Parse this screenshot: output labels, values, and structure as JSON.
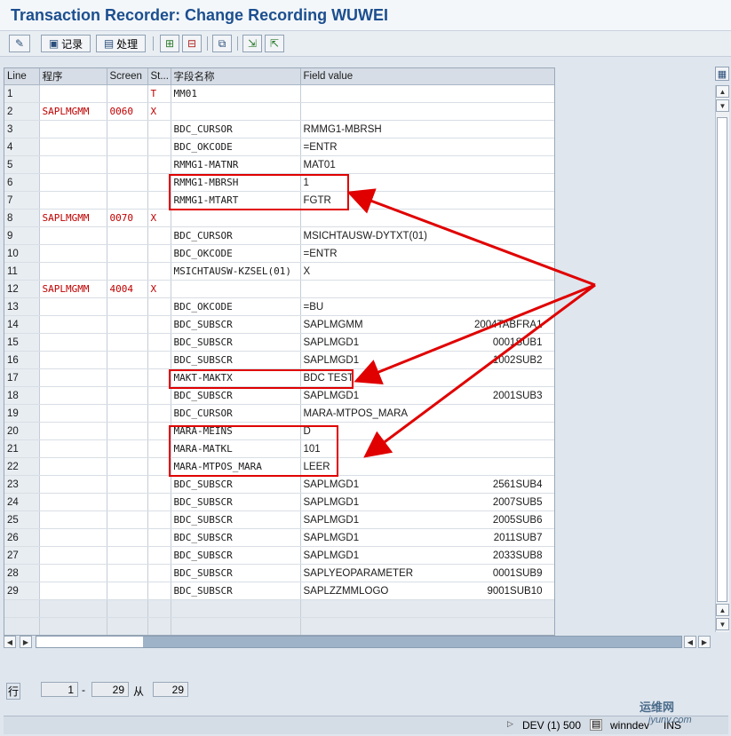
{
  "window": {
    "title": "Transaction Recorder: Change Recording WUWEI"
  },
  "toolbar": {
    "record_label": "记录",
    "process_label": "处理"
  },
  "grid": {
    "columns": [
      "Line",
      "程序",
      "Screen",
      "St...",
      "字段名称",
      "Field value"
    ],
    "rows": [
      {
        "line": "1",
        "program": "",
        "screen": "",
        "st": "T",
        "field": "MM01",
        "value": "",
        "value2": ""
      },
      {
        "line": "2",
        "program": "SAPLMGMM",
        "screen": "0060",
        "st": "X",
        "field": "",
        "value": "",
        "value2": ""
      },
      {
        "line": "3",
        "program": "",
        "screen": "",
        "st": "",
        "field": "BDC_CURSOR",
        "value": "RMMG1-MBRSH",
        "value2": ""
      },
      {
        "line": "4",
        "program": "",
        "screen": "",
        "st": "",
        "field": "BDC_OKCODE",
        "value": "=ENTR",
        "value2": ""
      },
      {
        "line": "5",
        "program": "",
        "screen": "",
        "st": "",
        "field": "RMMG1-MATNR",
        "value": "MAT01",
        "value2": ""
      },
      {
        "line": "6",
        "program": "",
        "screen": "",
        "st": "",
        "field": "RMMG1-MBRSH",
        "value": "1",
        "value2": ""
      },
      {
        "line": "7",
        "program": "",
        "screen": "",
        "st": "",
        "field": "RMMG1-MTART",
        "value": "FGTR",
        "value2": ""
      },
      {
        "line": "8",
        "program": "SAPLMGMM",
        "screen": "0070",
        "st": "X",
        "field": "",
        "value": "",
        "value2": ""
      },
      {
        "line": "9",
        "program": "",
        "screen": "",
        "st": "",
        "field": "BDC_CURSOR",
        "value": "MSICHTAUSW-DYTXT(01)",
        "value2": ""
      },
      {
        "line": "10",
        "program": "",
        "screen": "",
        "st": "",
        "field": "BDC_OKCODE",
        "value": "=ENTR",
        "value2": ""
      },
      {
        "line": "11",
        "program": "",
        "screen": "",
        "st": "",
        "field": "MSICHTAUSW-KZSEL(01)",
        "value": "X",
        "value2": ""
      },
      {
        "line": "12",
        "program": "SAPLMGMM",
        "screen": "4004",
        "st": "X",
        "field": "",
        "value": "",
        "value2": ""
      },
      {
        "line": "13",
        "program": "",
        "screen": "",
        "st": "",
        "field": "BDC_OKCODE",
        "value": "=BU",
        "value2": ""
      },
      {
        "line": "14",
        "program": "",
        "screen": "",
        "st": "",
        "field": "BDC_SUBSCR",
        "value": "SAPLMGMM",
        "value2": "2004TABFRA1"
      },
      {
        "line": "15",
        "program": "",
        "screen": "",
        "st": "",
        "field": "BDC_SUBSCR",
        "value": "SAPLMGD1",
        "value2": "0001SUB1"
      },
      {
        "line": "16",
        "program": "",
        "screen": "",
        "st": "",
        "field": "BDC_SUBSCR",
        "value": "SAPLMGD1",
        "value2": "1002SUB2"
      },
      {
        "line": "17",
        "program": "",
        "screen": "",
        "st": "",
        "field": "MAKT-MAKTX",
        "value": "BDC TEST",
        "value2": ""
      },
      {
        "line": "18",
        "program": "",
        "screen": "",
        "st": "",
        "field": "BDC_SUBSCR",
        "value": "SAPLMGD1",
        "value2": "2001SUB3"
      },
      {
        "line": "19",
        "program": "",
        "screen": "",
        "st": "",
        "field": "BDC_CURSOR",
        "value": "MARA-MTPOS_MARA",
        "value2": ""
      },
      {
        "line": "20",
        "program": "",
        "screen": "",
        "st": "",
        "field": "MARA-MEINS",
        "value": "D",
        "value2": ""
      },
      {
        "line": "21",
        "program": "",
        "screen": "",
        "st": "",
        "field": "MARA-MATKL",
        "value": "101",
        "value2": ""
      },
      {
        "line": "22",
        "program": "",
        "screen": "",
        "st": "",
        "field": "MARA-MTPOS_MARA",
        "value": "LEER",
        "value2": ""
      },
      {
        "line": "23",
        "program": "",
        "screen": "",
        "st": "",
        "field": "BDC_SUBSCR",
        "value": "SAPLMGD1",
        "value2": "2561SUB4"
      },
      {
        "line": "24",
        "program": "",
        "screen": "",
        "st": "",
        "field": "BDC_SUBSCR",
        "value": "SAPLMGD1",
        "value2": "2007SUB5"
      },
      {
        "line": "25",
        "program": "",
        "screen": "",
        "st": "",
        "field": "BDC_SUBSCR",
        "value": "SAPLMGD1",
        "value2": "2005SUB6"
      },
      {
        "line": "26",
        "program": "",
        "screen": "",
        "st": "",
        "field": "BDC_SUBSCR",
        "value": "SAPLMGD1",
        "value2": "2011SUB7"
      },
      {
        "line": "27",
        "program": "",
        "screen": "",
        "st": "",
        "field": "BDC_SUBSCR",
        "value": "SAPLMGD1",
        "value2": "2033SUB8"
      },
      {
        "line": "28",
        "program": "",
        "screen": "",
        "st": "",
        "field": "BDC_SUBSCR",
        "value": "SAPLYEOPARAMETER",
        "value2": "0001SUB9"
      },
      {
        "line": "29",
        "program": "",
        "screen": "",
        "st": "",
        "field": "BDC_SUBSCR",
        "value": "SAPLZZMMLOGO",
        "value2": "9001SUB10"
      }
    ]
  },
  "navigator": {
    "row_label": "行",
    "from": "1",
    "dash": "-",
    "to": "29",
    "of_label": "从",
    "total": "29"
  },
  "status": {
    "system": "DEV (1) 500",
    "server": "winndev",
    "mode": "INS"
  },
  "watermark": {
    "brand": "运维网",
    "url": "iyunv.com"
  },
  "colors": {
    "title": "#1c4f8f",
    "annotation": "#e00000",
    "program_text": "#c00000"
  }
}
